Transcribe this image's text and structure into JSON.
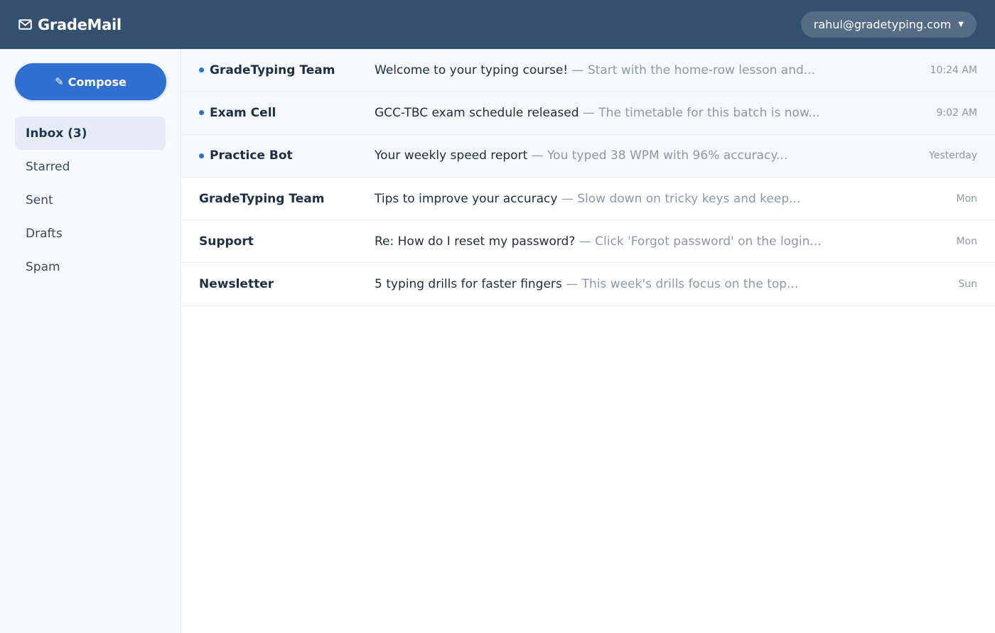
{
  "app": {
    "name": "GradeMail",
    "account": "rahul@gradetyping.com"
  },
  "sidebar": {
    "compose_label": "Compose",
    "folders": [
      {
        "label": "Inbox (3)",
        "active": true
      },
      {
        "label": "Starred",
        "active": false
      },
      {
        "label": "Sent",
        "active": false
      },
      {
        "label": "Drafts",
        "active": false
      },
      {
        "label": "Spam",
        "active": false
      }
    ]
  },
  "separator": "—",
  "emails": [
    {
      "sender": "GradeTyping Team",
      "subject": "Welcome to your typing course!",
      "snippet": "Start with the home-row lesson and...",
      "time": "10:24 AM",
      "unread": true
    },
    {
      "sender": "Exam Cell",
      "subject": "GCC-TBC exam schedule released",
      "snippet": "The timetable for this batch is now...",
      "time": "9:02 AM",
      "unread": true
    },
    {
      "sender": "Practice Bot",
      "subject": "Your weekly speed report",
      "snippet": "You typed 38 WPM with 96% accuracy...",
      "time": "Yesterday",
      "unread": true
    },
    {
      "sender": "GradeTyping Team",
      "subject": "Tips to improve your accuracy",
      "snippet": "Slow down on tricky keys and keep...",
      "time": "Mon",
      "unread": false
    },
    {
      "sender": "Support",
      "subject": "Re: How do I reset my password?",
      "snippet": "Click 'Forgot password' on the login...",
      "time": "Mon",
      "unread": false
    },
    {
      "sender": "Newsletter",
      "subject": "5 typing drills for faster fingers",
      "snippet": "This week's drills focus on the top...",
      "time": "Sun",
      "unread": false
    }
  ],
  "icons": {
    "brand": "envelope-icon",
    "compose": "pencil-icon",
    "account": "chevron-down-icon",
    "unread": "unread-dot-icon"
  },
  "colors": {
    "header": "#34506f",
    "accent": "#2f6fd1",
    "sidebar_bg": "#f6f9fd",
    "unread_row_bg": "#f5f8fc"
  }
}
